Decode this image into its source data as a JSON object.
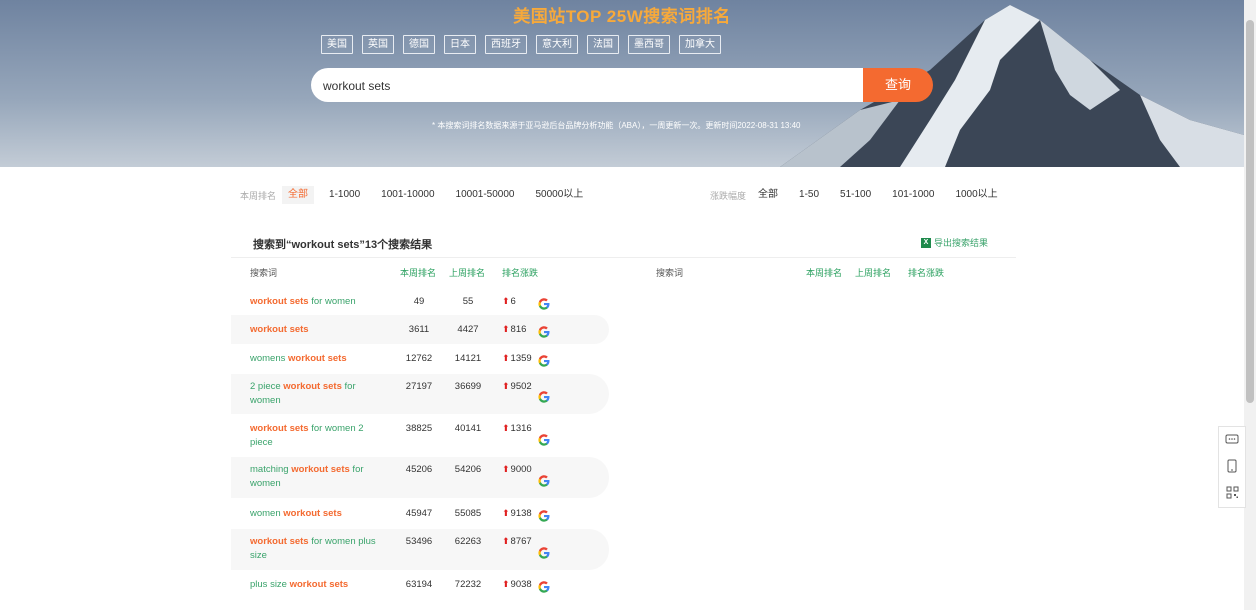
{
  "hero": {
    "title": "美国站TOP 25W搜索词排名",
    "countries": [
      "美国",
      "英国",
      "德国",
      "日本",
      "西班牙",
      "意大利",
      "法国",
      "墨西哥",
      "加拿大"
    ],
    "search_value": "workout sets",
    "search_button": "查询",
    "note": "* 本搜索词排名数据来源于亚马逊后台品牌分析功能（ABA），一周更新一次。更新时间2022-08-31 13:40"
  },
  "filters": {
    "rank_label": "本周排名",
    "rank_options": [
      "全部",
      "1-1000",
      "1001-10000",
      "10001-50000",
      "50000以上"
    ],
    "rank_active": "全部",
    "change_label": "涨跌幅度",
    "change_options": [
      "全部",
      "1-50",
      "51-100",
      "101-1000",
      "1000以上"
    ]
  },
  "results": {
    "title": "搜索到“workout sets”13个搜索结果",
    "export_label": "导出搜索结果",
    "headers": {
      "keyword": "搜索词",
      "this_week": "本周排名",
      "last_week": "上周排名",
      "change": "排名涨跌"
    },
    "rows": [
      {
        "pre": "",
        "hl": "workout sets",
        "post": " for women",
        "this_week": "49",
        "last_week": "55",
        "change": "6"
      },
      {
        "pre": "",
        "hl": "workout sets",
        "post": "",
        "this_week": "3611",
        "last_week": "4427",
        "change": "816"
      },
      {
        "pre": "womens ",
        "hl": "workout sets",
        "post": "",
        "this_week": "12762",
        "last_week": "14121",
        "change": "1359"
      },
      {
        "pre": "2 piece ",
        "hl": "workout sets",
        "post": " for women",
        "this_week": "27197",
        "last_week": "36699",
        "change": "9502"
      },
      {
        "pre": "",
        "hl": "workout sets",
        "post": " for women 2 piece",
        "this_week": "38825",
        "last_week": "40141",
        "change": "1316"
      },
      {
        "pre": "matching ",
        "hl": "workout sets",
        "post": " for women",
        "this_week": "45206",
        "last_week": "54206",
        "change": "9000"
      },
      {
        "pre": "women ",
        "hl": "workout sets",
        "post": "",
        "this_week": "45947",
        "last_week": "55085",
        "change": "9138"
      },
      {
        "pre": "",
        "hl": "workout sets",
        "post": " for women plus size",
        "this_week": "53496",
        "last_week": "62263",
        "change": "8767"
      },
      {
        "pre": "plus size ",
        "hl": "workout sets",
        "post": "",
        "this_week": "63194",
        "last_week": "72232",
        "change": "9038"
      }
    ]
  },
  "colors": {
    "accent": "#f46a30",
    "green": "#3aa36b",
    "title_gold": "#f7a93b"
  }
}
